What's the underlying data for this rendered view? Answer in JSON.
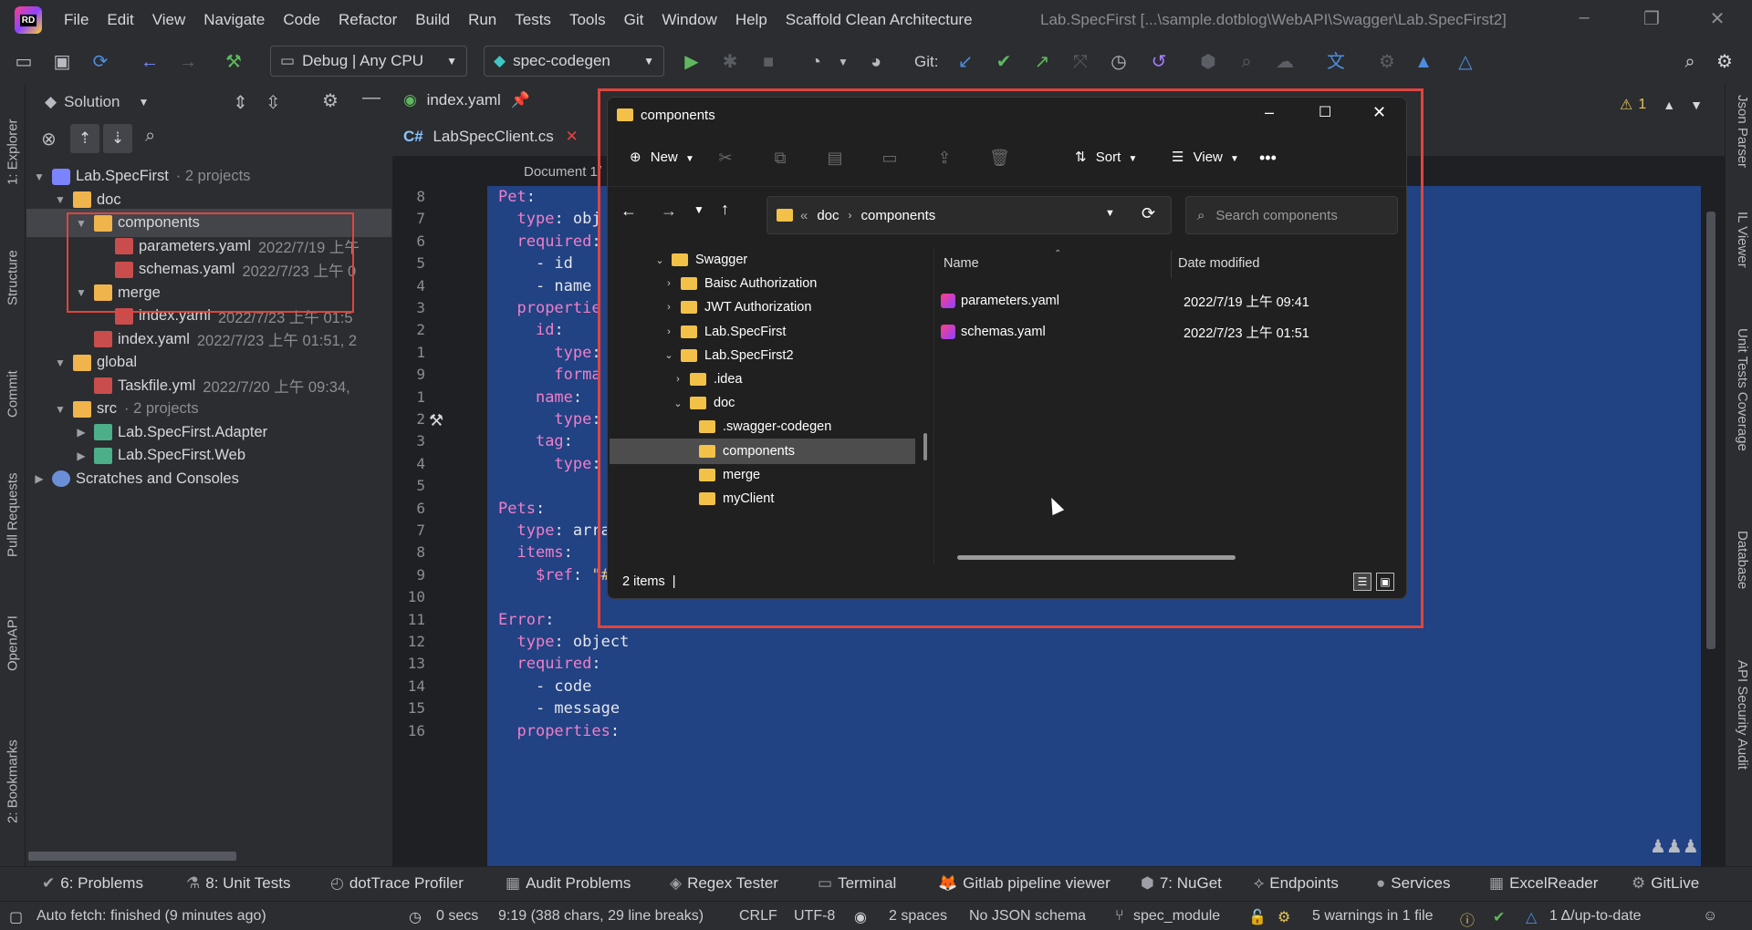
{
  "menu": {
    "items": [
      "File",
      "Edit",
      "View",
      "Navigate",
      "Code",
      "Refactor",
      "Build",
      "Run",
      "Tests",
      "Tools",
      "Git",
      "Window",
      "Help",
      "Scaffold Clean Architecture"
    ],
    "window_title": "Lab.SpecFirst [...\\sample.dotblog\\WebAPI\\Swagger\\Lab.SpecFirst2]"
  },
  "toolbar": {
    "config": "Debug | Any CPU",
    "run_config": "spec-codegen",
    "git_label": "Git:"
  },
  "left_tabs": [
    "1: Explorer",
    "Structure",
    "Commit",
    "Pull Requests",
    "OpenAPI",
    "2: Bookmarks"
  ],
  "right_tabs": [
    "Json Parser",
    "IL Viewer",
    "Unit Tests Coverage",
    "Database",
    "API Security Audit"
  ],
  "solution": {
    "header": "Solution",
    "rows": [
      {
        "label": "Lab.SpecFirst",
        "meta": "· 2 projects",
        "level": 0,
        "icon": "proj",
        "expanded": true
      },
      {
        "label": "doc",
        "meta": "",
        "level": 1,
        "icon": "folder",
        "expanded": true
      },
      {
        "label": "components",
        "meta": "",
        "level": 2,
        "icon": "folder",
        "expanded": true,
        "selected": true
      },
      {
        "label": "parameters.yaml",
        "meta": "2022/7/19 上午",
        "level": 3,
        "icon": "yaml"
      },
      {
        "label": "schemas.yaml",
        "meta": "2022/7/23 上午 0",
        "level": 3,
        "icon": "yaml"
      },
      {
        "label": "merge",
        "meta": "",
        "level": 2,
        "icon": "folder",
        "expanded": true
      },
      {
        "label": "index.yaml",
        "meta": "2022/7/23 上午 01:5",
        "level": 3,
        "icon": "yaml"
      },
      {
        "label": "index.yaml",
        "meta": "2022/7/23 上午 01:51, 2",
        "level": 2,
        "icon": "yaml"
      },
      {
        "label": "global",
        "meta": "",
        "level": 1,
        "icon": "folder",
        "expanded": true
      },
      {
        "label": "Taskfile.yml",
        "meta": "2022/7/20 上午 09:34,",
        "level": 2,
        "icon": "yaml"
      },
      {
        "label": "src",
        "meta": "· 2 projects",
        "level": 1,
        "icon": "folder",
        "expanded": true
      },
      {
        "label": "Lab.SpecFirst.Adapter",
        "meta": "",
        "level": 2,
        "icon": "csproj",
        "expanded": false
      },
      {
        "label": "Lab.SpecFirst.Web",
        "meta": "",
        "level": 2,
        "icon": "csproj",
        "expanded": false
      },
      {
        "label": "Scratches and Consoles",
        "meta": "",
        "level": 0,
        "icon": "scratch",
        "expanded": false
      }
    ]
  },
  "editor": {
    "tab1": "index.yaml",
    "tab2": "LabSpecClient.cs",
    "doc_crumb": "Document 1/",
    "warnings": "1",
    "lines": [
      {
        "n": "8",
        "code": [
          [
            "k",
            "Pet"
          ],
          [
            "t",
            ":"
          ]
        ]
      },
      {
        "n": "7",
        "code": [
          [
            "t",
            "  "
          ],
          [
            "k",
            "type"
          ],
          [
            "t",
            ": obj"
          ]
        ]
      },
      {
        "n": "6",
        "code": [
          [
            "t",
            "  "
          ],
          [
            "k",
            "required"
          ],
          [
            "t",
            ":"
          ]
        ]
      },
      {
        "n": "5",
        "code": [
          [
            "t",
            "    - id"
          ]
        ]
      },
      {
        "n": "4",
        "code": [
          [
            "t",
            "    - name"
          ]
        ]
      },
      {
        "n": "3",
        "code": [
          [
            "t",
            "  "
          ],
          [
            "k",
            "propertie"
          ]
        ]
      },
      {
        "n": "2",
        "code": [
          [
            "t",
            "    "
          ],
          [
            "k",
            "id"
          ],
          [
            "t",
            ":"
          ]
        ]
      },
      {
        "n": "1",
        "code": [
          [
            "t",
            "      "
          ],
          [
            "k",
            "type"
          ],
          [
            "t",
            ":"
          ]
        ]
      },
      {
        "n": "9",
        "code": [
          [
            "t",
            "      "
          ],
          [
            "k",
            "forma"
          ]
        ]
      },
      {
        "n": "1",
        "code": [
          [
            "t",
            "    "
          ],
          [
            "k",
            "name"
          ],
          [
            "t",
            ":"
          ]
        ]
      },
      {
        "n": "2",
        "code": [
          [
            "t",
            "      "
          ],
          [
            "k",
            "type"
          ],
          [
            "t",
            ":"
          ]
        ]
      },
      {
        "n": "3",
        "code": [
          [
            "t",
            "    "
          ],
          [
            "k",
            "tag"
          ],
          [
            "t",
            ":"
          ]
        ]
      },
      {
        "n": "4",
        "code": [
          [
            "t",
            "      "
          ],
          [
            "k",
            "type"
          ],
          [
            "t",
            ":"
          ]
        ]
      },
      {
        "n": "5",
        "code": []
      },
      {
        "n": "6",
        "code": [
          [
            "k",
            "Pets"
          ],
          [
            "t",
            ":"
          ]
        ]
      },
      {
        "n": "7",
        "code": [
          [
            "t",
            "  "
          ],
          [
            "k",
            "type"
          ],
          [
            "t",
            ": array"
          ]
        ]
      },
      {
        "n": "8",
        "code": [
          [
            "t",
            "  "
          ],
          [
            "k",
            "items"
          ],
          [
            "t",
            ":"
          ]
        ]
      },
      {
        "n": "9",
        "code": [
          [
            "t",
            "    "
          ],
          [
            "k",
            "$ref"
          ],
          [
            "t",
            ": "
          ],
          [
            "s",
            "\"#/Pet\""
          ]
        ]
      },
      {
        "n": "10",
        "code": []
      },
      {
        "n": "11",
        "code": [
          [
            "k",
            "Error"
          ],
          [
            "t",
            ":"
          ]
        ]
      },
      {
        "n": "12",
        "code": [
          [
            "t",
            "  "
          ],
          [
            "k",
            "type"
          ],
          [
            "t",
            ": object"
          ]
        ]
      },
      {
        "n": "13",
        "code": [
          [
            "t",
            "  "
          ],
          [
            "k",
            "required"
          ],
          [
            "t",
            ":"
          ]
        ]
      },
      {
        "n": "14",
        "code": [
          [
            "t",
            "    - code"
          ]
        ]
      },
      {
        "n": "15",
        "code": [
          [
            "t",
            "    - message"
          ]
        ]
      },
      {
        "n": "16",
        "code": [
          [
            "t",
            "  "
          ],
          [
            "k",
            "properties"
          ],
          [
            "t",
            ":"
          ]
        ]
      }
    ]
  },
  "explorer": {
    "title": "components",
    "cmd": {
      "new": "New",
      "sort": "Sort",
      "view": "View"
    },
    "address": {
      "parts": [
        "«",
        "doc",
        "components"
      ]
    },
    "search_placeholder": "Search components",
    "nav": [
      {
        "label": "Swagger",
        "indent": 0,
        "chev": "v"
      },
      {
        "label": "Baisc Authorization",
        "indent": 1,
        "chev": ">"
      },
      {
        "label": "JWT Authorization",
        "indent": 1,
        "chev": ">"
      },
      {
        "label": "Lab.SpecFirst",
        "indent": 1,
        "chev": ">"
      },
      {
        "label": "Lab.SpecFirst2",
        "indent": 1,
        "chev": "v"
      },
      {
        "label": ".idea",
        "indent": 2,
        "chev": ">"
      },
      {
        "label": "doc",
        "indent": 2,
        "chev": "v"
      },
      {
        "label": ".swagger-codegen",
        "indent": 3,
        "chev": ""
      },
      {
        "label": "components",
        "indent": 3,
        "chev": "",
        "selected": true
      },
      {
        "label": "merge",
        "indent": 3,
        "chev": ""
      },
      {
        "label": "myClient",
        "indent": 3,
        "chev": ""
      }
    ],
    "columns": {
      "name": "Name",
      "date": "Date modified"
    },
    "files": [
      {
        "name": "parameters.yaml",
        "date": "2022/7/19 上午 09:41"
      },
      {
        "name": "schemas.yaml",
        "date": "2022/7/23 上午 01:51"
      }
    ],
    "status": "2 items"
  },
  "toolwindows": [
    {
      "label": "6: Problems",
      "icon": "check-icon"
    },
    {
      "label": "8: Unit Tests",
      "icon": "tests-icon"
    },
    {
      "label": "dotTrace Profiler",
      "icon": "profiler-icon"
    },
    {
      "label": "Audit Problems",
      "icon": "audit-icon"
    },
    {
      "label": "Regex Tester",
      "icon": "regex-icon"
    },
    {
      "label": "Terminal",
      "icon": "terminal-icon"
    },
    {
      "label": "Gitlab pipeline viewer",
      "icon": "gitlab-icon"
    },
    {
      "label": "7: NuGet",
      "icon": "nuget-icon"
    },
    {
      "label": "Endpoints",
      "icon": "endpoints-icon"
    },
    {
      "label": "Services",
      "icon": "services-icon"
    },
    {
      "label": "ExcelReader",
      "icon": "excel-icon"
    },
    {
      "label": "GitLive",
      "icon": "gitlive-icon"
    }
  ],
  "status": {
    "fetch": "Auto fetch: finished (9 minutes ago)",
    "secs": "0 secs",
    "selection": "9:19 (388 chars, 29 line breaks)",
    "crlf": "CRLF",
    "encoding": "UTF-8",
    "indent": "2 spaces",
    "schema": "No JSON schema",
    "branch": "spec_module",
    "warnings": "5 warnings in 1 file",
    "uptodate": "1 Δ/up-to-date"
  },
  "colors": {
    "accent_red": "#e0443f",
    "selection_bg": "#214283",
    "keyword": "#f07fc8",
    "folder": "#f3c148"
  }
}
